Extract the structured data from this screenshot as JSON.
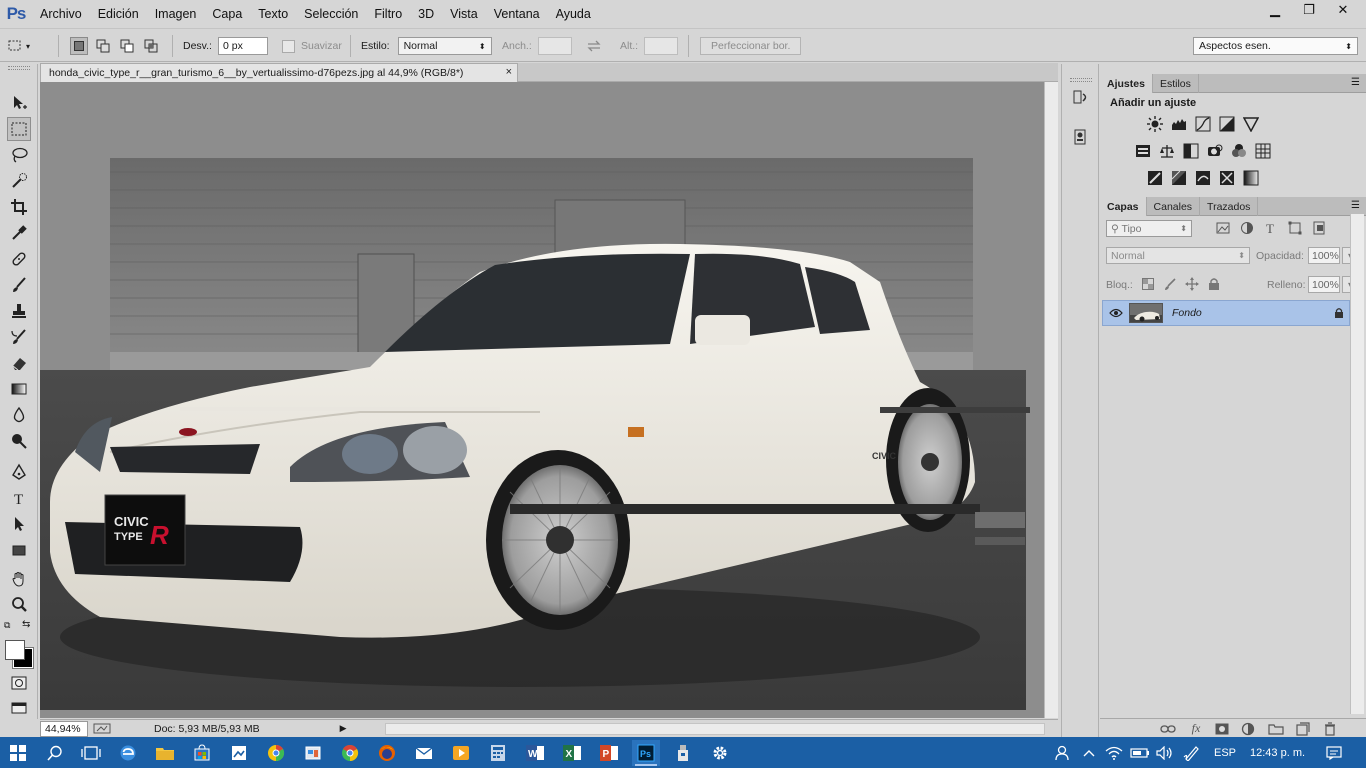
{
  "app": {
    "logo": "Ps"
  },
  "menu": {
    "items": [
      "Archivo",
      "Edición",
      "Imagen",
      "Capa",
      "Texto",
      "Selección",
      "Filtro",
      "3D",
      "Vista",
      "Ventana",
      "Ayuda"
    ]
  },
  "window_controls": {
    "minimize": "▁",
    "restore": "❐",
    "close": "✕"
  },
  "options": {
    "feather_label": "Desv.:",
    "feather_value": "0 px",
    "antialias_label": "Suavizar",
    "style_label": "Estilo:",
    "style_value": "Normal",
    "width_label": "Anch.:",
    "height_label": "Alt.:",
    "refine_label": "Perfeccionar bor.",
    "workspace_value": "Aspectos esen."
  },
  "document": {
    "tab_title": "honda_civic_type_r__gran_turismo_6__by_vertualissimo-d76pezs.jpg al 44,9% (RGB/8*)",
    "close": "×",
    "zoom": "44,94%",
    "doc_info": "Doc: 5,93 MB/5,93 MB",
    "plate_line1": "CIVIC",
    "plate_line2": "TYPE",
    "plate_r": "R"
  },
  "adjustments": {
    "tabs": [
      "Ajustes",
      "Estilos"
    ],
    "title": "Añadir un ajuste"
  },
  "layers": {
    "tabs": [
      "Capas",
      "Canales",
      "Trazados"
    ],
    "filter_placeholder": "Tipo",
    "blend_mode": "Normal",
    "opacity_label": "Opacidad:",
    "opacity_value": "100%",
    "lock_label": "Bloq.:",
    "fill_label": "Relleno:",
    "fill_value": "100%",
    "layer_name": "Fondo"
  },
  "taskbar": {
    "language": "ESP",
    "time": "12:43 p. m."
  },
  "colors": {
    "taskbar": "#1b5fa5",
    "panel_bg": "#d6d6d6",
    "layer_selected": "#a9c3e8",
    "car_body": "#f1eee6"
  }
}
